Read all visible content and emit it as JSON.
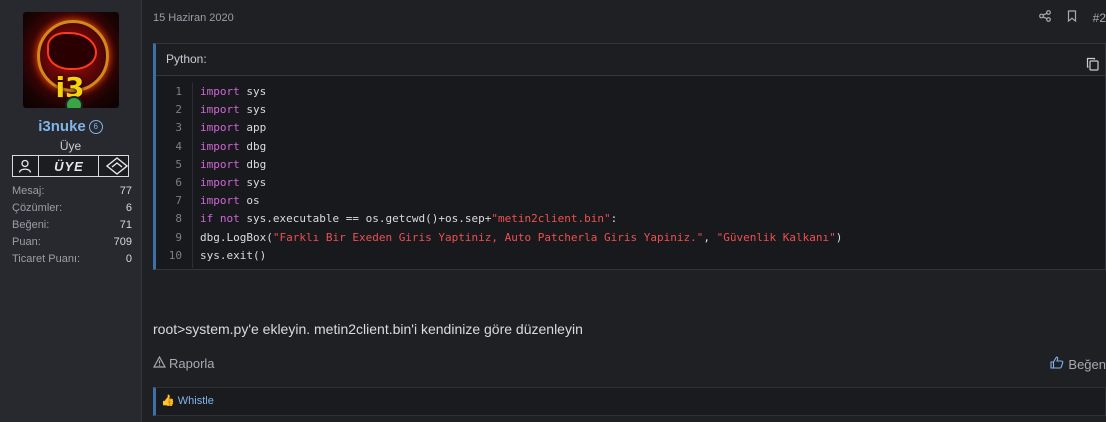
{
  "user": {
    "name": "i3nuke",
    "badge": "6",
    "title": "Üye",
    "rank": "ÜYE",
    "stats": [
      {
        "key": "Mesaj:",
        "value": "77"
      },
      {
        "key": "Çözümler:",
        "value": "6"
      },
      {
        "key": "Beğeni:",
        "value": "71"
      },
      {
        "key": "Puan:",
        "value": "709"
      },
      {
        "key": "Ticaret Puanı:",
        "value": "0"
      }
    ]
  },
  "post": {
    "date": "15 Haziran 2020",
    "number": "#2",
    "code": {
      "language": "Python:",
      "line_numbers": [
        "1",
        "2",
        "3",
        "4",
        "5",
        "6",
        "7",
        "8",
        "9",
        "10"
      ],
      "lines": [
        [
          {
            "t": "import",
            "c": "kw"
          },
          {
            "t": " sys",
            "c": ""
          }
        ],
        [
          {
            "t": "import",
            "c": "kw"
          },
          {
            "t": " sys",
            "c": ""
          }
        ],
        [
          {
            "t": "import",
            "c": "kw"
          },
          {
            "t": " app",
            "c": ""
          }
        ],
        [
          {
            "t": "import",
            "c": "kw"
          },
          {
            "t": " dbg",
            "c": ""
          }
        ],
        [
          {
            "t": "import",
            "c": "kw"
          },
          {
            "t": " dbg",
            "c": ""
          }
        ],
        [
          {
            "t": "import",
            "c": "kw"
          },
          {
            "t": " sys",
            "c": ""
          }
        ],
        [
          {
            "t": "import",
            "c": "kw"
          },
          {
            "t": " os",
            "c": ""
          }
        ],
        [
          {
            "t": "if",
            "c": "kw"
          },
          {
            "t": " ",
            "c": ""
          },
          {
            "t": "not",
            "c": "kw"
          },
          {
            "t": " sys.executable == os.getcwd()+os.sep+",
            "c": ""
          },
          {
            "t": "\"metin2client.bin\"",
            "c": "str"
          },
          {
            "t": ":",
            "c": ""
          }
        ],
        [
          {
            "t": "dbg.LogBox(",
            "c": ""
          },
          {
            "t": "\"Farklı Bir Exeden Giris Yaptiniz, Auto Patcherla Giris Yapiniz.\"",
            "c": "str"
          },
          {
            "t": ", ",
            "c": ""
          },
          {
            "t": "\"Güvenlik Kalkanı\"",
            "c": "str"
          },
          {
            "t": ")",
            "c": ""
          }
        ],
        [
          {
            "t": "sys.exit()",
            "c": ""
          }
        ]
      ]
    },
    "message": "root>system.py'e ekleyin. metin2client.bin'i kendinize göre düzenleyin",
    "report_label": "Raporla",
    "like_label": "Beğen",
    "reaction_user": "Whistle"
  },
  "icons": [
    "share-icon",
    "bookmark-icon",
    "copy-icon",
    "warning-icon",
    "thumbs-up-icon",
    "user-icon",
    "rank-emblem-icon"
  ]
}
